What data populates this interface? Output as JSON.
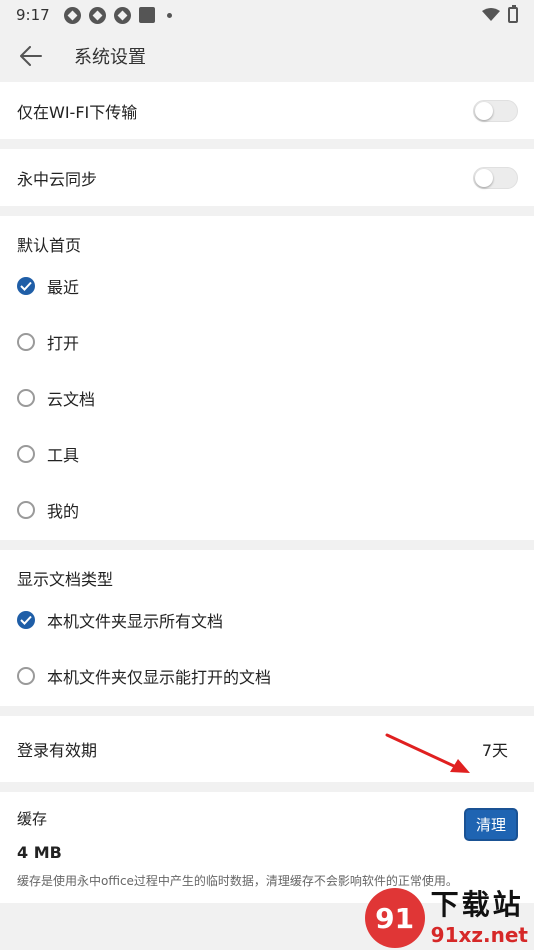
{
  "status_bar": {
    "time": "9:17"
  },
  "header": {
    "title": "系统设置"
  },
  "wifi": {
    "label": "仅在WI-FI下传输",
    "enabled": false
  },
  "cloud": {
    "label": "永中云同步",
    "enabled": false
  },
  "default_home": {
    "title": "默认首页",
    "options": [
      "最近",
      "打开",
      "云文档",
      "工具",
      "我的"
    ],
    "selected": "最近"
  },
  "doc_types": {
    "title": "显示文档类型",
    "options": [
      "本机文件夹显示所有文档",
      "本机文件夹仅显示能打开的文档"
    ],
    "selected": "本机文件夹显示所有文档"
  },
  "login_validity": {
    "label": "登录有效期",
    "value": "7天"
  },
  "cache": {
    "label": "缓存",
    "size": "4 MB",
    "description": "缓存是使用永中office过程中产生的临时数据，清理缓存不会影响软件的正常使用。",
    "clear_label": "清理"
  },
  "colors": {
    "accent": "#1f5ea7",
    "arrow": "#e02020"
  },
  "watermark": {
    "mark": "91",
    "top": "下载站",
    "bottom": "91xz.net"
  }
}
